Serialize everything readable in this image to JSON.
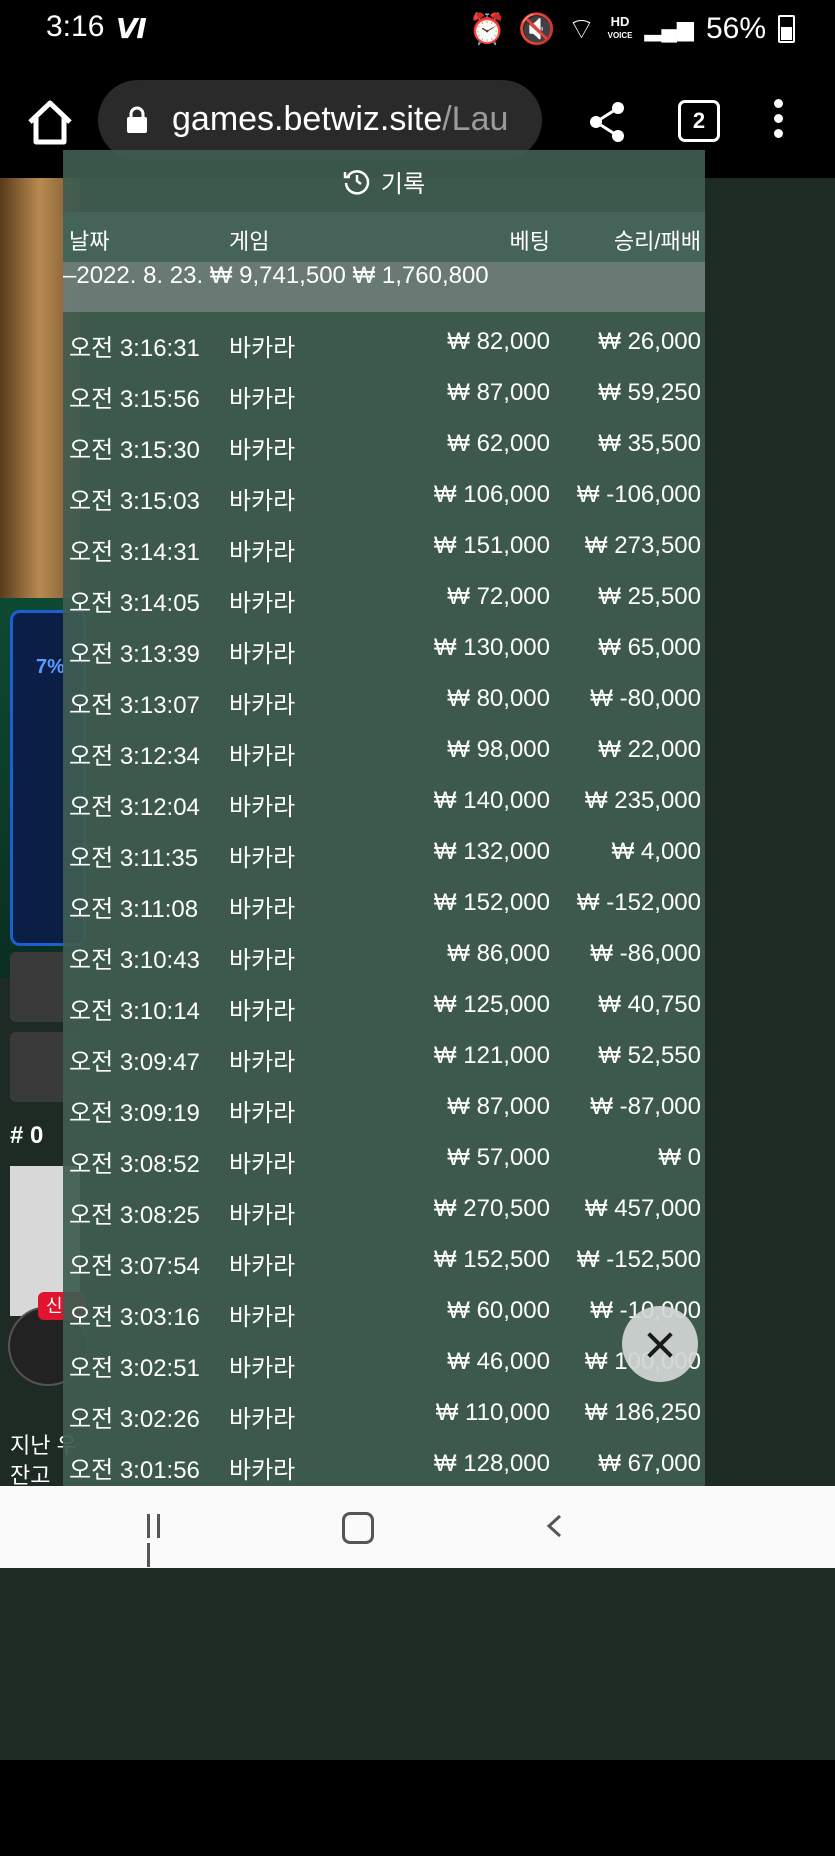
{
  "status_bar": {
    "time": "3:16",
    "volte": "Ⅵ",
    "hd_top": "HD",
    "hd_bottom": "VOICE",
    "battery": "56%"
  },
  "browser": {
    "url_host": "games.betwiz.site",
    "url_path": "/Lau",
    "tab_count": "2"
  },
  "game_background": {
    "ring_percent": "7%",
    "hash_label": "# 0",
    "new_badge": "신",
    "bottom_line1": "지난 우",
    "bottom_line2": "잔고"
  },
  "history": {
    "title": "기록",
    "columns": {
      "date": "날짜",
      "game": "게임",
      "bet": "베팅",
      "win_loss": "승리/패배"
    },
    "day_summary": {
      "date": "–2022. 8. 23.",
      "bet": "₩ 9,741,500",
      "win_loss": "₩ 1,760,800"
    },
    "rows": [
      {
        "time": "오전 3:16:31",
        "game": "바카라",
        "bet": "₩ 82,000",
        "result": "₩ 26,000"
      },
      {
        "time": "오전 3:15:56",
        "game": "바카라",
        "bet": "₩ 87,000",
        "result": "₩ 59,250"
      },
      {
        "time": "오전 3:15:30",
        "game": "바카라",
        "bet": "₩ 62,000",
        "result": "₩ 35,500"
      },
      {
        "time": "오전 3:15:03",
        "game": "바카라",
        "bet": "₩ 106,000",
        "result": "₩ -106,000"
      },
      {
        "time": "오전 3:14:31",
        "game": "바카라",
        "bet": "₩ 151,000",
        "result": "₩ 273,500"
      },
      {
        "time": "오전 3:14:05",
        "game": "바카라",
        "bet": "₩ 72,000",
        "result": "₩ 25,500"
      },
      {
        "time": "오전 3:13:39",
        "game": "바카라",
        "bet": "₩ 130,000",
        "result": "₩ 65,000"
      },
      {
        "time": "오전 3:13:07",
        "game": "바카라",
        "bet": "₩ 80,000",
        "result": "₩ -80,000"
      },
      {
        "time": "오전 3:12:34",
        "game": "바카라",
        "bet": "₩ 98,000",
        "result": "₩ 22,000"
      },
      {
        "time": "오전 3:12:04",
        "game": "바카라",
        "bet": "₩ 140,000",
        "result": "₩ 235,000"
      },
      {
        "time": "오전 3:11:35",
        "game": "바카라",
        "bet": "₩ 132,000",
        "result": "₩ 4,000"
      },
      {
        "time": "오전 3:11:08",
        "game": "바카라",
        "bet": "₩ 152,000",
        "result": "₩ -152,000"
      },
      {
        "time": "오전 3:10:43",
        "game": "바카라",
        "bet": "₩ 86,000",
        "result": "₩ -86,000"
      },
      {
        "time": "오전 3:10:14",
        "game": "바카라",
        "bet": "₩ 125,000",
        "result": "₩ 40,750"
      },
      {
        "time": "오전 3:09:47",
        "game": "바카라",
        "bet": "₩ 121,000",
        "result": "₩ 52,550"
      },
      {
        "time": "오전 3:09:19",
        "game": "바카라",
        "bet": "₩ 87,000",
        "result": "₩ -87,000"
      },
      {
        "time": "오전 3:08:52",
        "game": "바카라",
        "bet": "₩ 57,000",
        "result": "₩ 0"
      },
      {
        "time": "오전 3:08:25",
        "game": "바카라",
        "bet": "₩ 270,500",
        "result": "₩ 457,000"
      },
      {
        "time": "오전 3:07:54",
        "game": "바카라",
        "bet": "₩ 152,500",
        "result": "₩ -152,500"
      },
      {
        "time": "오전 3:03:16",
        "game": "바카라",
        "bet": "₩ 60,000",
        "result": "₩ -10,000"
      },
      {
        "time": "오전 3:02:51",
        "game": "바카라",
        "bet": "₩ 46,000",
        "result": "₩ 100,000"
      },
      {
        "time": "오전 3:02:26",
        "game": "바카라",
        "bet": "₩ 110,000",
        "result": "₩ 186,250"
      },
      {
        "time": "오전 3:01:56",
        "game": "바카라",
        "bet": "₩ 128,000",
        "result": "₩ 67,000"
      }
    ]
  },
  "icons": {
    "home": "home-icon",
    "lock": "lock-icon",
    "share": "share-icon",
    "menu": "more-vert-icon",
    "history": "clock-history-icon",
    "close": "close-icon"
  },
  "colors": {
    "panel_bg": "#3e5c50",
    "day_row_bg": "#8c9694",
    "url_bar_bg": "#2a2a2a",
    "nav_bar_bg": "#fafafa"
  }
}
